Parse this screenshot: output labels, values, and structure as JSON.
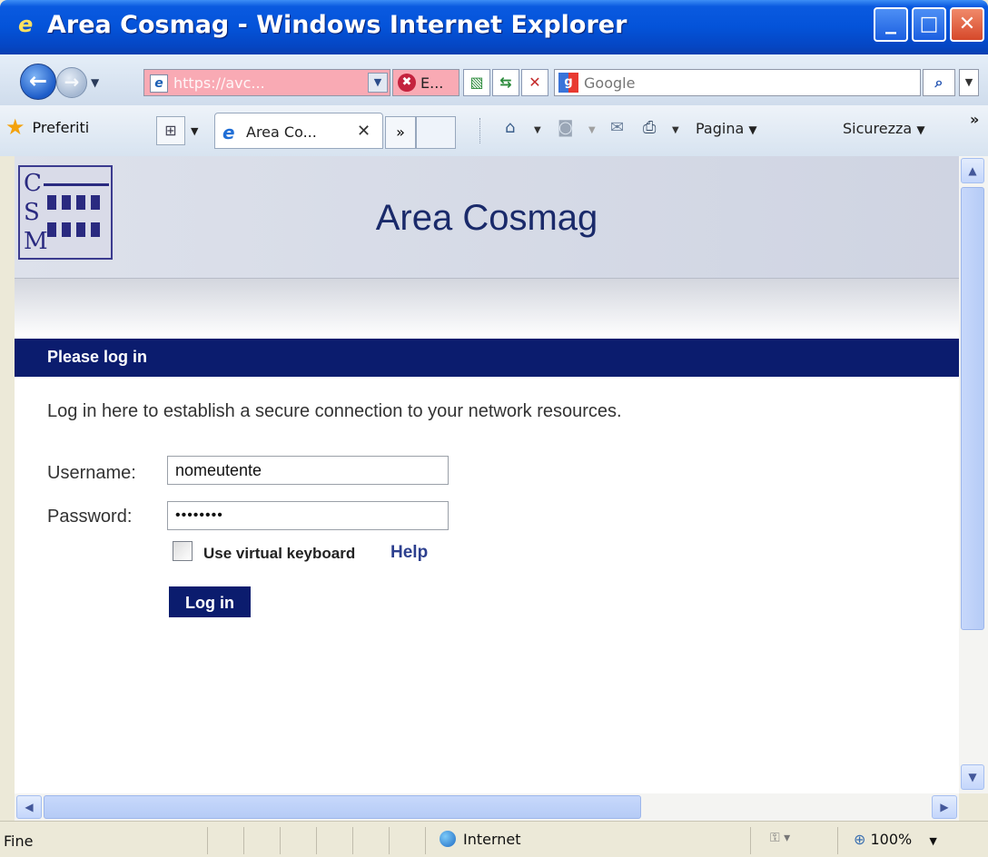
{
  "window": {
    "title": "Area Cosmag - Windows Internet Explorer",
    "buttons": {
      "minimize": "_",
      "maximize": "□",
      "close": "✕"
    }
  },
  "navbar": {
    "address": "https://avc...",
    "cert_error_label": "E...",
    "search_placeholder": "Google",
    "search_go": "⌕"
  },
  "commandbar": {
    "favorites_label": "Preferiti",
    "tab_label": "Area Co...",
    "tab_more": "»",
    "page_menu": "Pagina",
    "security_menu": "Sicurezza",
    "more_chevrons": "»"
  },
  "page": {
    "title": "Area Cosmag",
    "logo_letters": [
      "C",
      "S",
      "M"
    ],
    "section_title": "Please log in",
    "intro": "Log in here to establish a secure connection to your network resources.",
    "username_label": "Username:",
    "username_value": "nomeutente",
    "password_label": "Password:",
    "password_value": "••••••••",
    "virtual_keyboard_label": "Use virtual keyboard",
    "help_link": "Help",
    "login_button": "Log in"
  },
  "status": {
    "text": "Fine",
    "zone": "Internet",
    "zoom": "100%"
  },
  "colors": {
    "title_bar": "#0453d9",
    "address_error": "#f9aab4",
    "page_navy": "#0b1c6e",
    "banner": "#d5d9e5"
  }
}
